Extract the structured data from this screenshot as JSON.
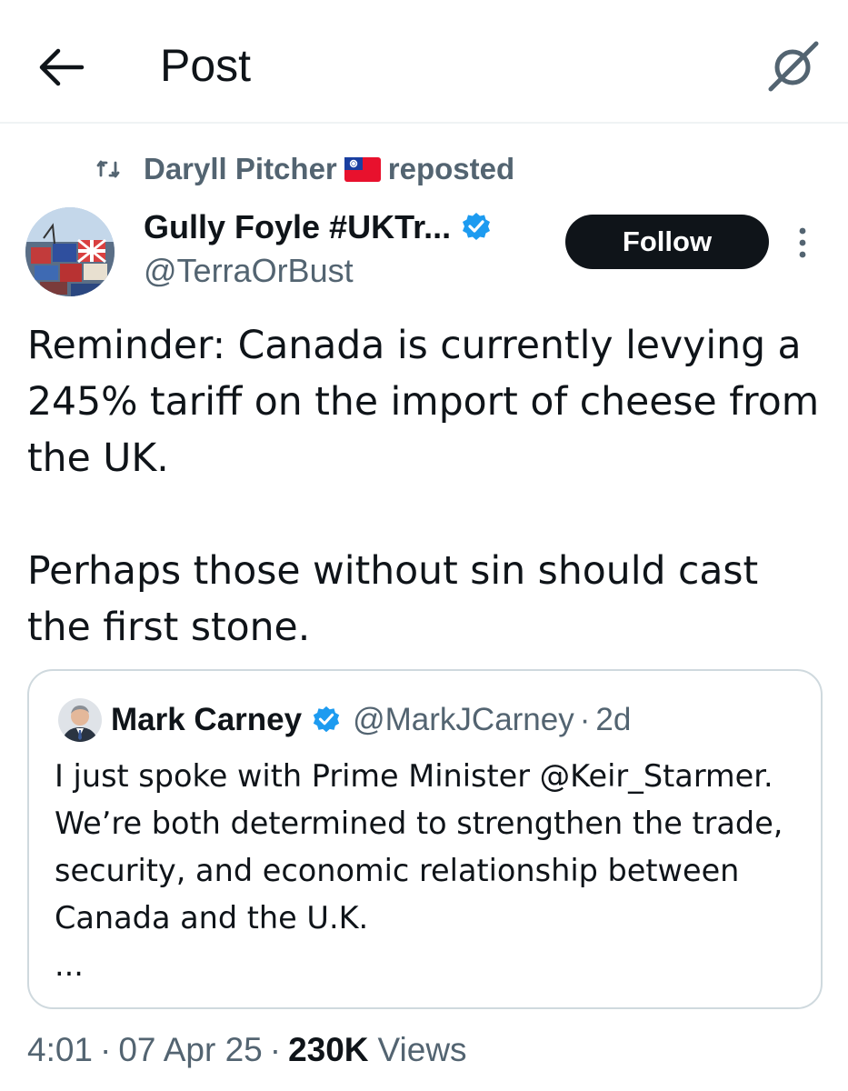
{
  "header": {
    "title": "Post",
    "back_icon": "arrow-left-icon",
    "grok_icon": "grok-icon"
  },
  "repost": {
    "user": "Daryll Pitcher",
    "flag": "taiwan-flag-icon",
    "label": "reposted"
  },
  "post": {
    "display_name": "Gully Foyle #UKTr...",
    "handle": "@TerraOrBust",
    "follow_label": "Follow",
    "text_p1": "Reminder: Canada is currently levying a 245% tariff on the import of cheese from the UK.",
    "text_p2": "Perhaps those without sin should cast the first stone.",
    "timestamp_time": "4:01",
    "timestamp_date": "07 Apr 25",
    "views_count": "230K",
    "views_label": "Views",
    "separator": "·"
  },
  "quote": {
    "display_name": "Mark Carney",
    "handle": "@MarkJCarney",
    "separator": "·",
    "time": "2d",
    "text": "I just spoke with Prime Minister @Keir_Starmer. We’re both determined to strengthen the trade, security, and economic relationship between Canada and the U.K.",
    "truncation": "..."
  },
  "colors": {
    "text_primary": "#0f1419",
    "text_secondary": "#536471",
    "verified_blue": "#1d9bf0",
    "border": "#cfd9de"
  }
}
